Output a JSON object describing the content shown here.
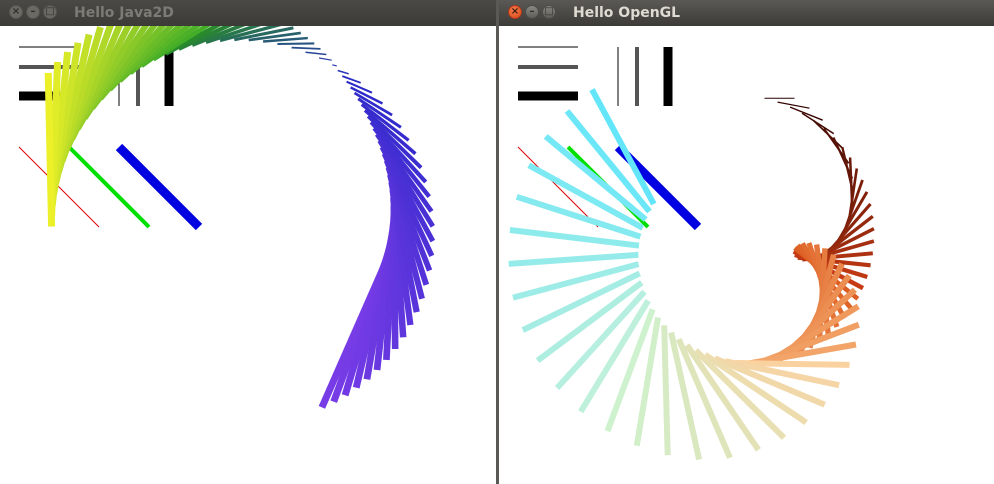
{
  "windows": {
    "left": {
      "title": "Hello Java2D"
    },
    "right": {
      "title": "Hello OpenGL"
    }
  },
  "icons": {
    "close": "close-icon",
    "minimize": "minimize-icon",
    "maximize": "maximize-icon"
  },
  "colors": {
    "desktop": "#3c3b37",
    "canvas": "#ffffff",
    "diag_red": "#dd0000",
    "diag_green": "#00e000",
    "diag_blue": "#0000e0"
  }
}
